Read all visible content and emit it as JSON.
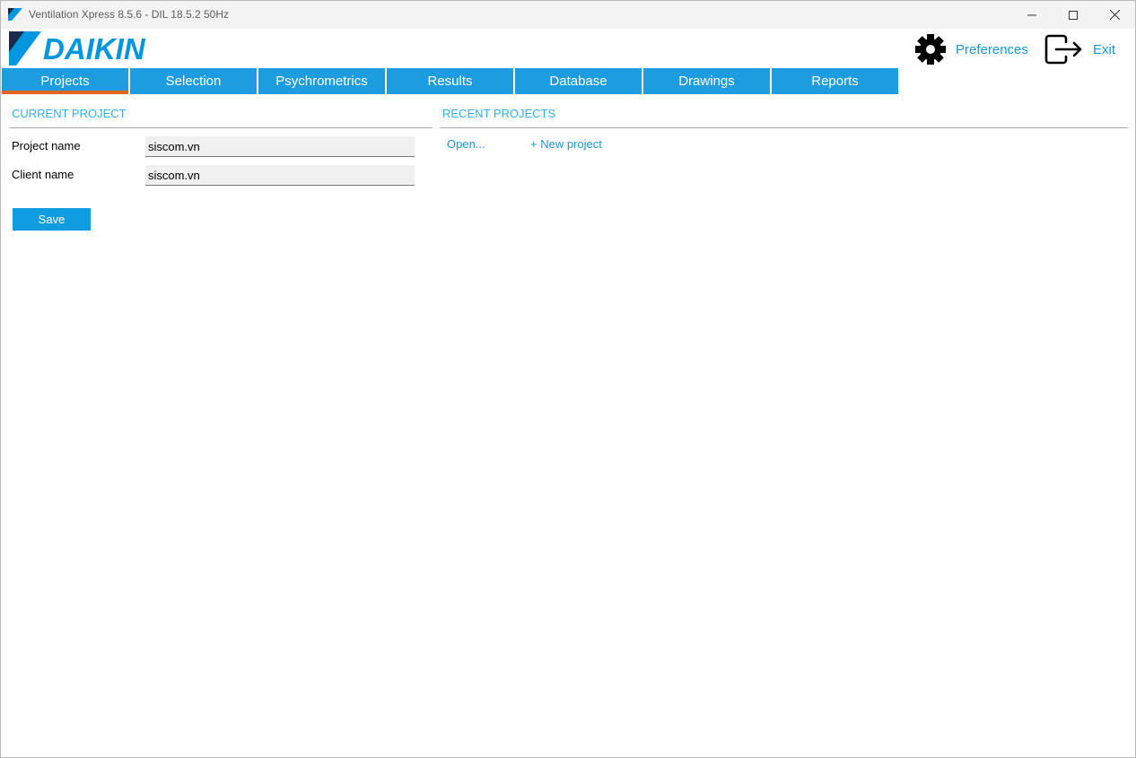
{
  "window": {
    "title": "Ventilation Xpress 8.5.6 - DIL 18.5.2 50Hz",
    "controls": [
      "minimize-icon",
      "maximize-icon",
      "close-icon"
    ]
  },
  "header": {
    "logo_text": "DAIKIN",
    "preferences_label": "Preferences",
    "exit_label": "Exit"
  },
  "tabs": [
    {
      "label": "Projects",
      "active": true
    },
    {
      "label": "Selection",
      "active": false
    },
    {
      "label": "Psychrometrics",
      "active": false
    },
    {
      "label": "Results",
      "active": false
    },
    {
      "label": "Database",
      "active": false
    },
    {
      "label": "Drawings",
      "active": false
    },
    {
      "label": "Reports",
      "active": false
    }
  ],
  "current_project": {
    "title": "CURRENT PROJECT",
    "project_name_label": "Project name",
    "project_name_value": "siscom.vn",
    "client_name_label": "Client name",
    "client_name_value": "siscom.vn",
    "save_label": "Save"
  },
  "recent_projects": {
    "title": "RECENT PROJECTS",
    "open_label": "Open...",
    "new_project_label": "+ New project"
  },
  "colors": {
    "accent": "#1d9ce0",
    "active_tab_indicator": "#e2651d",
    "section_title": "#33b0e8",
    "brand": "#0097e0"
  }
}
